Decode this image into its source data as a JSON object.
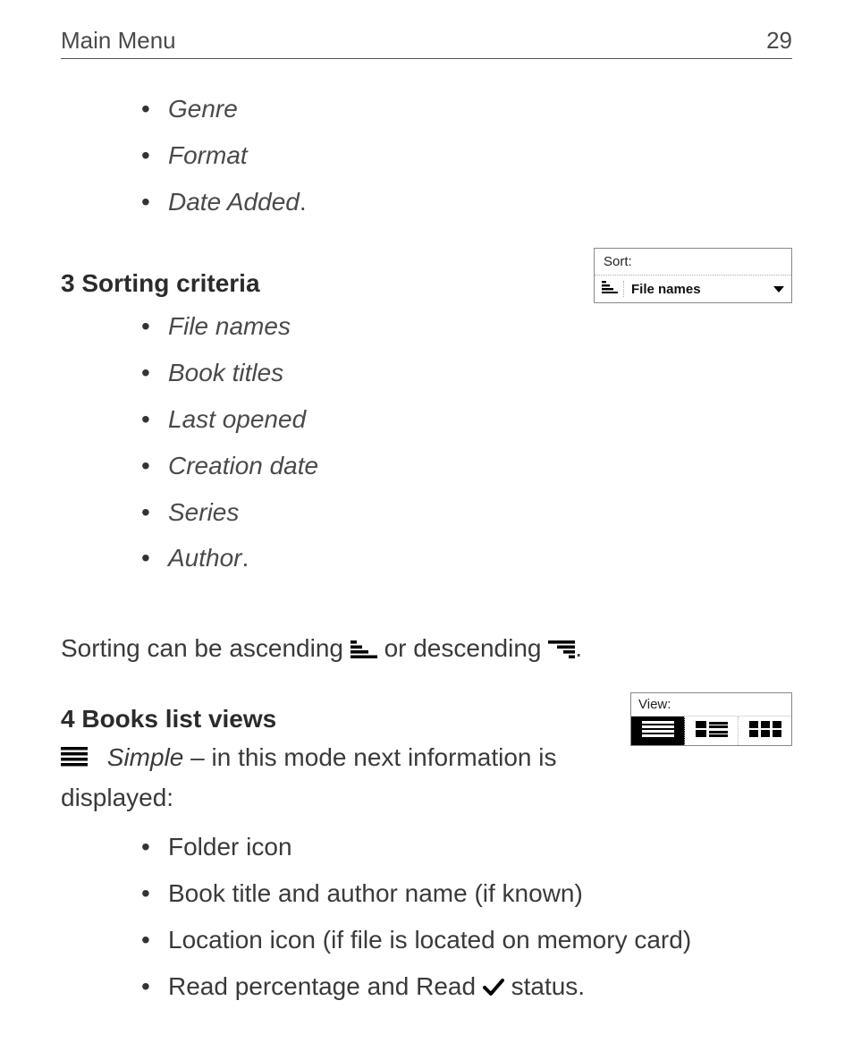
{
  "header": {
    "title": "Main Menu",
    "page_number": "29"
  },
  "top_list": [
    "Genre",
    "Format",
    "Date Added"
  ],
  "sort_widget": {
    "label": "Sort:",
    "value": "File names",
    "icon": "sort-ascending-icon",
    "caret": "dropdown-caret-icon"
  },
  "section3": {
    "heading": "3 Sorting criteria",
    "items": [
      "File names",
      "Book titles",
      "Last opened",
      "Creation date",
      "Series",
      "Author"
    ]
  },
  "sorting_sentence": {
    "part1": "Sorting can be ascending ",
    "part2": " or descending ",
    "period": "."
  },
  "view_widget": {
    "label": "View:",
    "options": [
      {
        "name": "view-simple",
        "active": true
      },
      {
        "name": "view-detailed",
        "active": false
      },
      {
        "name": "view-thumbnail",
        "active": false
      }
    ]
  },
  "section4": {
    "heading": "4 Books list views",
    "simple_def": {
      "label": "Simple",
      "rest": " – in this mode next information is displayed:"
    },
    "items": [
      {
        "text": "Folder icon"
      },
      {
        "text": "Book title and author name (if known)"
      },
      {
        "text": "Location icon (if file is located on memory card)"
      },
      {
        "prefix": "Read percentage and ",
        "italic": "Read",
        "icon": "checkmark-icon",
        "suffix": " status."
      }
    ]
  }
}
